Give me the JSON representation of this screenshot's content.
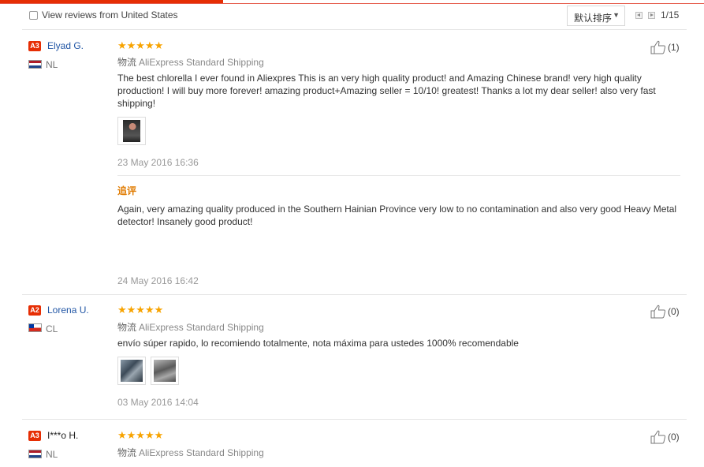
{
  "filter": {
    "checkbox_label": "View reviews from United States",
    "sort_label": "默认排序",
    "page_indicator": "1/15"
  },
  "reviews": [
    {
      "level": "A3",
      "name": "Elyad G.",
      "country": "NL",
      "stars": "★★★★★",
      "shipping_label": "物流",
      "shipping": "AliExpress Standard Shipping",
      "text": "The best chlorella I ever found in Aliexpres This is an very high quality product! and Amazing Chinese brand! very high quality production! I will buy more forever! amazing product+Amazing seller = 10/10! greatest! Thanks a lot my dear seller! also very fast shipping!",
      "date": "23 May 2016 16:36",
      "followup_label": "追评",
      "followup_text": "Again, very amazing quality produced in the Southern Hainian Province very low to no contamination and also very good Heavy Metal detector! Insanely good product!",
      "followup_date": "24 May 2016 16:42",
      "helpful_count": "(1)"
    },
    {
      "level": "A2",
      "name": "Lorena U.",
      "country": "CL",
      "stars": "★★★★★",
      "shipping_label": "物流",
      "shipping": "AliExpress Standard Shipping",
      "text": "envío súper rapido, lo recomiendo totalmente, nota máxima para ustedes 1000% recomendable",
      "date": "03 May 2016 14:04",
      "helpful_count": "(0)"
    },
    {
      "level": "A3",
      "name": "I***o H.",
      "country": "NL",
      "stars": "★★★★★",
      "shipping_label": "物流",
      "shipping": "AliExpress Standard Shipping",
      "helpful_count": "(0)"
    }
  ]
}
